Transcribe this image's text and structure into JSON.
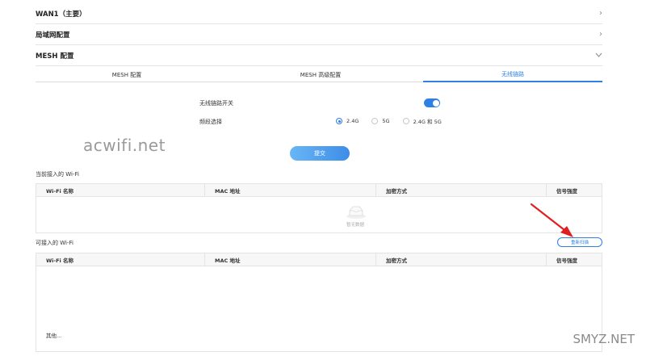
{
  "sections": [
    {
      "label": "WAN1（主要）",
      "state": "collapsed"
    },
    {
      "label": "局域网配置",
      "state": "collapsed"
    },
    {
      "label": "MESH 配置",
      "state": "expanded"
    }
  ],
  "subtabs": [
    {
      "label": "MESH 配置",
      "active": false
    },
    {
      "label": "MESH 高级配置",
      "active": false
    },
    {
      "label": "无线链路",
      "active": true
    }
  ],
  "form": {
    "switch_label": "无线链路开关",
    "switch_on": true,
    "band_label": "频段选择",
    "band_options": [
      {
        "label": "2.4G",
        "checked": true
      },
      {
        "label": "5G",
        "checked": false
      },
      {
        "label": "2.4G 和 5G",
        "checked": false
      }
    ],
    "submit_label": "提交"
  },
  "current_wifi": {
    "title": "当前接入的 Wi-Fi",
    "columns": [
      "Wi-Fi 名称",
      "MAC 地址",
      "加密方式",
      "信号强度"
    ],
    "empty_text": "暂无数据"
  },
  "available_wifi": {
    "title": "可接入的 Wi-Fi",
    "rescan_label": "重新扫描",
    "columns": [
      "Wi-Fi 名称",
      "MAC 地址",
      "加密方式",
      "信号强度"
    ],
    "more_label": "其他..."
  },
  "watermarks": {
    "left": "acwifi.net",
    "right": "SMYZ.NET"
  },
  "colors": {
    "accent": "#2f7fe5",
    "annotation_arrow": "#e02020"
  }
}
